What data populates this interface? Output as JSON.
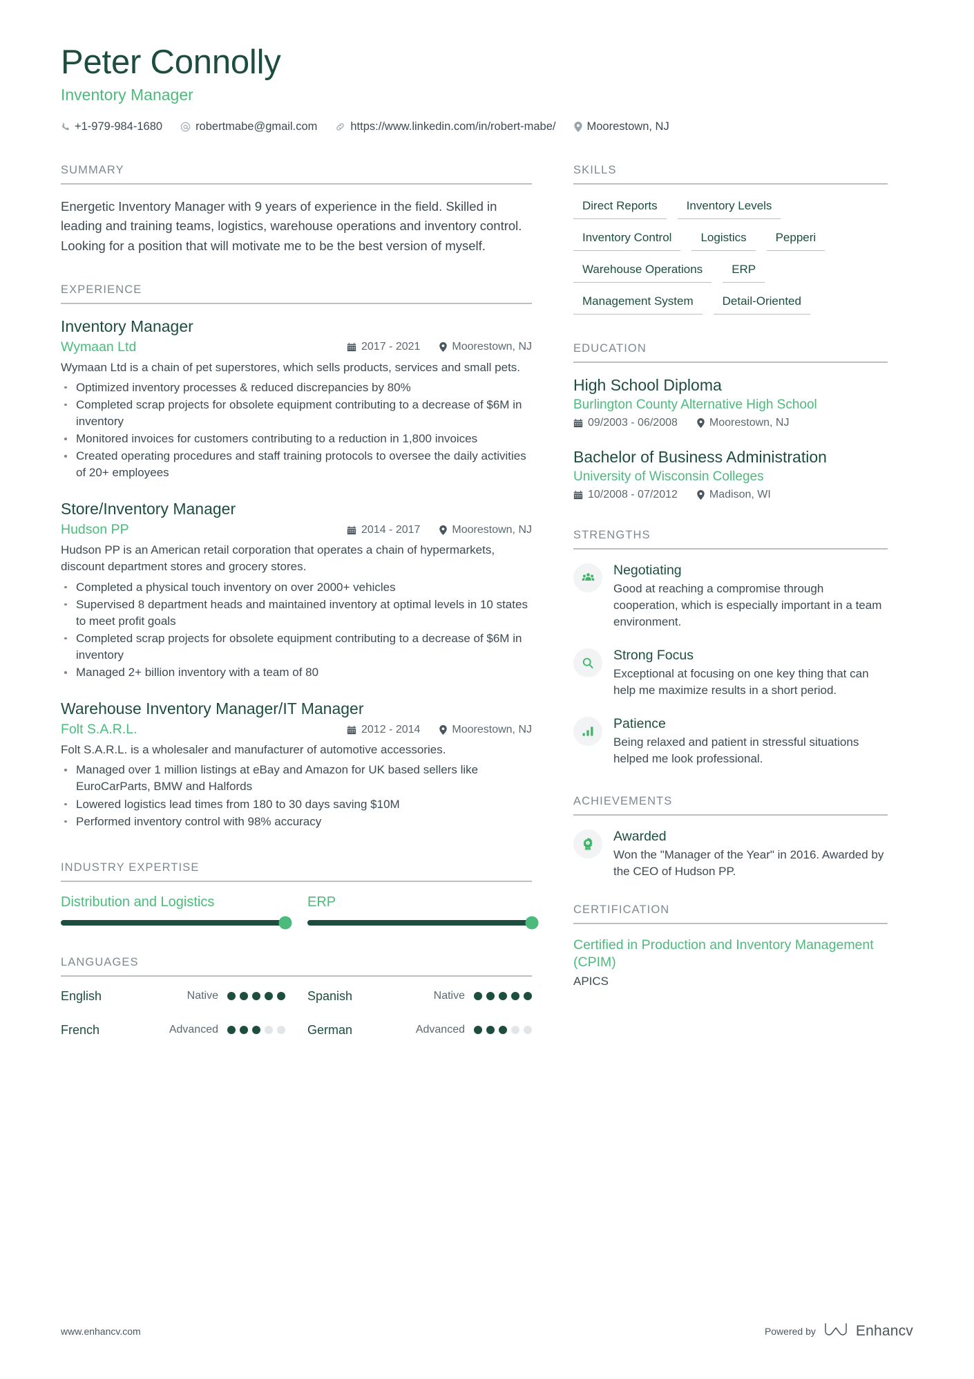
{
  "header": {
    "name": "Peter Connolly",
    "job_title": "Inventory Manager",
    "contacts": [
      {
        "icon": "phone-icon",
        "text": "+1-979-984-1680"
      },
      {
        "icon": "email-icon",
        "text": "robertmabe@gmail.com"
      },
      {
        "icon": "link-icon",
        "text": "https://www.linkedin.com/in/robert-mabe/"
      },
      {
        "icon": "location-pin-icon",
        "text": "Moorestown, NJ"
      }
    ]
  },
  "summary": {
    "title": "SUMMARY",
    "text": "Energetic Inventory Manager with 9 years of experience in the field. Skilled in leading and training teams, logistics, warehouse operations and inventory control. Looking for a position that will motivate me to be the best version of myself."
  },
  "experience": {
    "title": "EXPERIENCE",
    "items": [
      {
        "role": "Inventory Manager",
        "company": "Wymaan Ltd",
        "dates": "2017 - 2021",
        "location": "Moorestown, NJ",
        "description": "Wymaan Ltd is a chain of pet superstores, which sells products, services and small pets.",
        "bullets": [
          "Optimized inventory processes & reduced discrepancies by 80%",
          "Completed scrap projects for obsolete equipment contributing to a decrease of $6M in inventory",
          "Monitored invoices for customers contributing to a reduction in 1,800 invoices",
          "Created operating procedures and staff training protocols to oversee the daily activities of 20+ employees"
        ]
      },
      {
        "role": "Store/Inventory Manager",
        "company": "Hudson PP",
        "dates": "2014 - 2017",
        "location": "Moorestown, NJ",
        "description": "Hudson PP is an American retail corporation that operates a chain of hypermarkets, discount department stores and grocery stores.",
        "bullets": [
          "Completed a physical touch inventory on over 2000+ vehicles",
          "Supervised 8 department heads and maintained inventory at optimal levels in 10 states to meet profit goals",
          "Completed scrap projects for obsolete equipment contributing to a decrease of $6M in inventory",
          "Managed 2+ billion inventory with a team of 80"
        ]
      },
      {
        "role": "Warehouse Inventory Manager/IT Manager",
        "company": "Folt S.A.R.L.",
        "dates": "2012 - 2014",
        "location": "Moorestown, NJ",
        "description": "Folt S.A.R.L. is a wholesaler and manufacturer of automotive accessories.",
        "bullets": [
          "Managed over 1 million listings at eBay and Amazon for UK based sellers like EuroCarParts, BMW and Halfords",
          "Lowered logistics lead times from 180 to 30 days saving $10M",
          "Performed inventory control with 98% accuracy"
        ]
      }
    ]
  },
  "industry_expertise": {
    "title": "INDUSTRY EXPERTISE",
    "items": [
      {
        "label": "Distribution and Logistics",
        "value": 100
      },
      {
        "label": "ERP",
        "value": 100
      }
    ]
  },
  "languages": {
    "title": "LANGUAGES",
    "max_dots": 5,
    "items": [
      {
        "name": "English",
        "level": "Native",
        "dots": 5
      },
      {
        "name": "Spanish",
        "level": "Native",
        "dots": 5
      },
      {
        "name": "French",
        "level": "Advanced",
        "dots": 3
      },
      {
        "name": "German",
        "level": "Advanced",
        "dots": 3
      }
    ]
  },
  "skills": {
    "title": "SKILLS",
    "items": [
      "Direct Reports",
      "Inventory Levels",
      "Inventory Control",
      "Logistics",
      "Pepperi",
      "Warehouse Operations",
      "ERP",
      "Management System",
      "Detail-Oriented"
    ]
  },
  "education": {
    "title": "EDUCATION",
    "items": [
      {
        "degree": "High School Diploma",
        "school": "Burlington County Alternative High School",
        "dates": "09/2003 - 06/2008",
        "location": "Moorestown, NJ"
      },
      {
        "degree": "Bachelor of Business Administration",
        "school": "University of Wisconsin Colleges",
        "dates": "10/2008 - 07/2012",
        "location": "Madison, WI"
      }
    ]
  },
  "strengths": {
    "title": "STRENGTHS",
    "items": [
      {
        "icon": "people-group-icon",
        "title": "Negotiating",
        "description": "Good at reaching a compromise through cooperation, which is especially important in a team environment."
      },
      {
        "icon": "magnifier-icon",
        "title": "Strong Focus",
        "description": "Exceptional at focusing on one key thing that can help me maximize results in a short period."
      },
      {
        "icon": "bar-chart-icon",
        "title": "Patience",
        "description": "Being relaxed and patient in stressful situations helped me look professional."
      }
    ]
  },
  "achievements": {
    "title": "ACHIEVEMENTS",
    "items": [
      {
        "icon": "award-ribbon-icon",
        "title": "Awarded",
        "description": "Won the \"Manager of the Year\" in 2016. Awarded by the CEO of Hudson PP."
      }
    ]
  },
  "certification": {
    "title": "CERTIFICATION",
    "items": [
      {
        "name": "Certified in Production and Inventory Management (CPIM)",
        "issuer": "APICS"
      }
    ]
  },
  "footer": {
    "url": "www.enhancv.com",
    "powered_by": "Powered by",
    "brand": "Enhancv"
  },
  "colors": {
    "dark_green": "#1d4d3f",
    "accent_green": "#4cba7c",
    "body_text": "#3c4a52",
    "muted": "#7d8991"
  }
}
